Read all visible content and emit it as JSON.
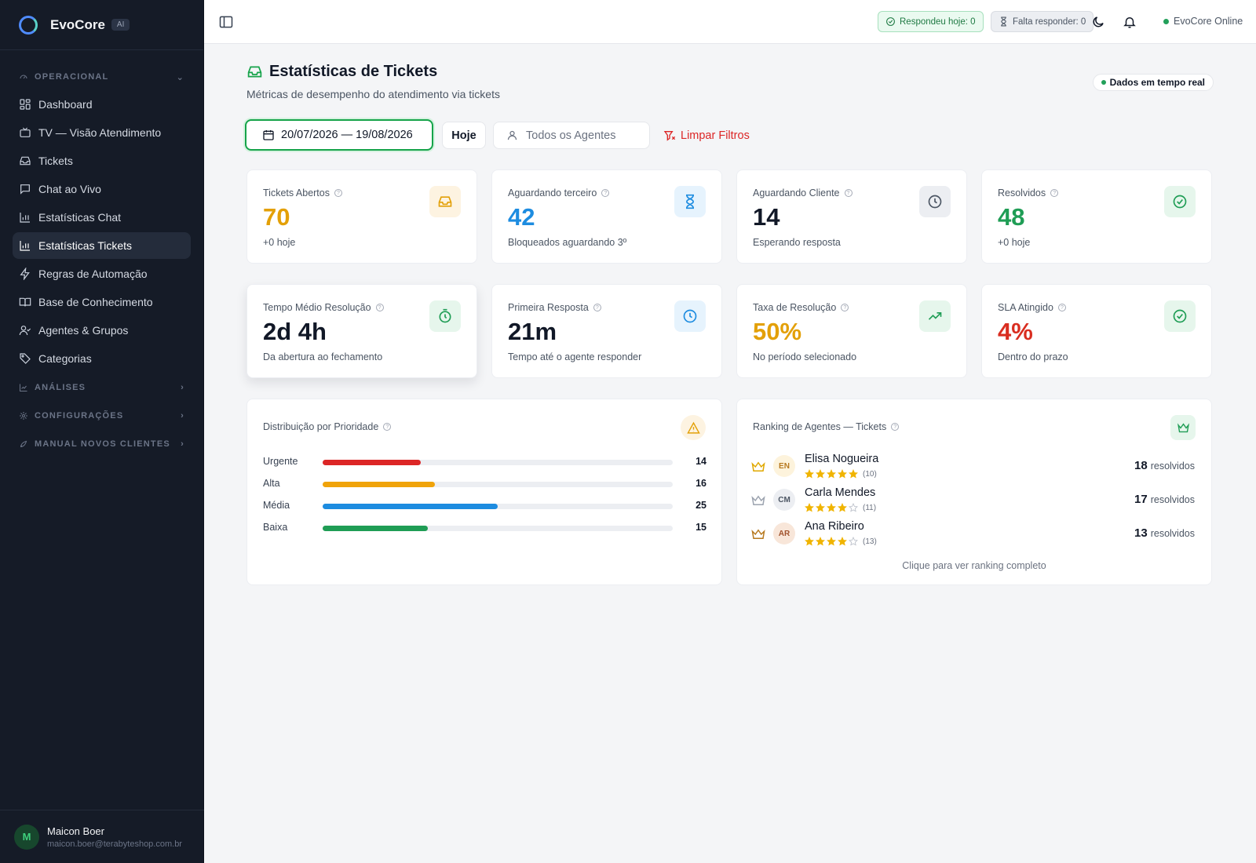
{
  "brand": {
    "name": "EvoCore",
    "badge": "AI"
  },
  "sidebar": {
    "sections": [
      {
        "label": "OPERACIONAL",
        "icon": "gauge-icon"
      },
      {
        "label": "ANÁLISES",
        "icon": "chart-icon"
      },
      {
        "label": "CONFIGURAÇÕES",
        "icon": "gear-icon"
      },
      {
        "label": "MANUAL NOVOS CLIENTES",
        "icon": "rocket-icon"
      }
    ],
    "items": [
      {
        "label": "Dashboard",
        "icon": "grid-icon"
      },
      {
        "label": "TV — Visão Atendimento",
        "icon": "tv-icon"
      },
      {
        "label": "Tickets",
        "icon": "inbox-icon"
      },
      {
        "label": "Chat ao Vivo",
        "icon": "chat-icon"
      },
      {
        "label": "Estatísticas Chat",
        "icon": "bar-chart-icon"
      },
      {
        "label": "Estatísticas Tickets",
        "icon": "bar-chart-icon",
        "active": true
      },
      {
        "label": "Regras de Automação",
        "icon": "bolt-icon"
      },
      {
        "label": "Base de Conhecimento",
        "icon": "book-icon"
      },
      {
        "label": "Agentes & Grupos",
        "icon": "users-icon"
      },
      {
        "label": "Categorias",
        "icon": "tag-icon"
      }
    ]
  },
  "user": {
    "initial": "M",
    "name": "Maicon Boer",
    "email": "maicon.boer@terabyteshop.com.br"
  },
  "topbar": {
    "answered_today": "Respondeu hoje: 0",
    "pending": "Falta responder: 0",
    "status": "EvoCore Online"
  },
  "page": {
    "title": "Estatísticas de Tickets",
    "subtitle": "Métricas de desempenho do atendimento via tickets",
    "realtime": "Dados em tempo real"
  },
  "filters": {
    "date_range": "20/07/2026 — 19/08/2026",
    "today": "Hoje",
    "agents_placeholder": "Todos os Agentes",
    "clear": "Limpar Filtros"
  },
  "stats": [
    {
      "label": "Tickets Abertos",
      "value": "70",
      "sub": "+0 hoje",
      "color": "#e3a008",
      "icon": "inbox-icon",
      "icon_bg": "#fdf3e1"
    },
    {
      "label": "Aguardando terceiro",
      "value": "42",
      "sub": "Bloqueados aguardando 3º",
      "color": "#1d8ce0",
      "icon": "hourglass-icon",
      "icon_bg": "#e6f3fd"
    },
    {
      "label": "Aguardando Cliente",
      "value": "14",
      "sub": "Esperando resposta",
      "color": "#111827",
      "icon": "clock-icon",
      "icon_bg": "#eceef2"
    },
    {
      "label": "Resolvidos",
      "value": "48",
      "sub": "+0 hoje",
      "color": "#1f9d55",
      "icon": "check-circle-icon",
      "icon_bg": "#e6f6ec"
    },
    {
      "label": "Tempo Médio Resolução",
      "value": "2d 4h",
      "sub": "Da abertura ao fechamento",
      "color": "#111827",
      "icon": "timer-icon",
      "icon_bg": "#e6f6ec"
    },
    {
      "label": "Primeira Resposta",
      "value": "21m",
      "sub": "Tempo até o agente responder",
      "color": "#111827",
      "icon": "clock-icon",
      "icon_bg": "#e6f3fd"
    },
    {
      "label": "Taxa de Resolução",
      "value": "50%",
      "sub": "No período selecionado",
      "color": "#e3a008",
      "icon": "trend-up-icon",
      "icon_bg": "#e6f6ec"
    },
    {
      "label": "SLA Atingido",
      "value": "4%",
      "sub": "Dentro do prazo",
      "color": "#d92d20",
      "icon": "check-circle-icon",
      "icon_bg": "#e6f6ec"
    }
  ],
  "priority": {
    "title": "Distribuição por Prioridade",
    "max": 50,
    "rows": [
      {
        "label": "Urgente",
        "value": 14,
        "color": "#dc2626"
      },
      {
        "label": "Alta",
        "value": 16,
        "color": "#f0a30a"
      },
      {
        "label": "Média",
        "value": 25,
        "color": "#1d8ce0"
      },
      {
        "label": "Baixa",
        "value": 15,
        "color": "#1f9d55"
      }
    ]
  },
  "ranking": {
    "title": "Ranking de Agentes — Tickets",
    "unit": "resolvidos",
    "footer": "Clique para ver ranking completo",
    "agents": [
      {
        "initials": "EN",
        "name": "Elisa Nogueira",
        "stars": 5,
        "count": "(10)",
        "resolved": "18",
        "crown": "#e0a800",
        "avatar_bg": "#fdf3dc",
        "avatar_fg": "#b7791f"
      },
      {
        "initials": "CM",
        "name": "Carla Mendes",
        "stars": 4,
        "count": "(11)",
        "resolved": "17",
        "crown": "#9ca3af",
        "avatar_bg": "#eceef2",
        "avatar_fg": "#4b5563"
      },
      {
        "initials": "AR",
        "name": "Ana Ribeiro",
        "stars": 4,
        "count": "(13)",
        "resolved": "13",
        "crown": "#b7791f",
        "avatar_bg": "#f8e6d9",
        "avatar_fg": "#a0522d"
      }
    ]
  }
}
